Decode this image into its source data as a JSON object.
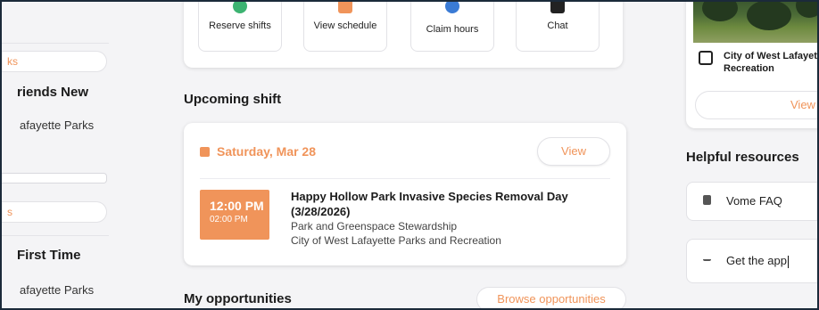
{
  "left_panel": {
    "pill_1": "ks",
    "card_1_title": "riends New",
    "card_1_sub": "afayette Parks",
    "pill_2": "s",
    "card_2_title": "First Time",
    "card_2_sub": "afayette Parks"
  },
  "quick_actions": [
    {
      "label": "Reserve shifts",
      "icon": "plus-circle-icon",
      "color": "#3cb371"
    },
    {
      "label": "View schedule",
      "icon": "calendar-icon",
      "color": "#f0945a"
    },
    {
      "label": "Claim hours",
      "icon": "clock-icon",
      "color": "#3a7bd5"
    },
    {
      "label": "Chat",
      "icon": "chat-icon",
      "color": "#222222"
    }
  ],
  "upcoming": {
    "title": "Upcoming shift",
    "date": "Saturday, Mar 28",
    "view_label": "View",
    "start_time": "12:00 PM",
    "end_time": "02:00 PM",
    "event_name": "Happy Hollow Park Invasive Species Removal Day (3/28/2026)",
    "category": "Park and Greenspace Stewardship",
    "organization": "City of West Lafayette Parks and Recreation"
  },
  "opportunities": {
    "title": "My opportunities",
    "browse_label": "Browse opportunities"
  },
  "org_card": {
    "name_line1": "City of West Lafayet",
    "name_line2": "Recreation",
    "view_label": "View"
  },
  "resources": {
    "title": "Helpful resources",
    "items": [
      {
        "label": "Vome FAQ",
        "icon": "document-icon"
      },
      {
        "label": "Get the app",
        "icon": "download-icon"
      }
    ]
  },
  "colors": {
    "accent": "#f0945a",
    "heading": "#1b1b1b",
    "background": "#f4f4f6"
  }
}
